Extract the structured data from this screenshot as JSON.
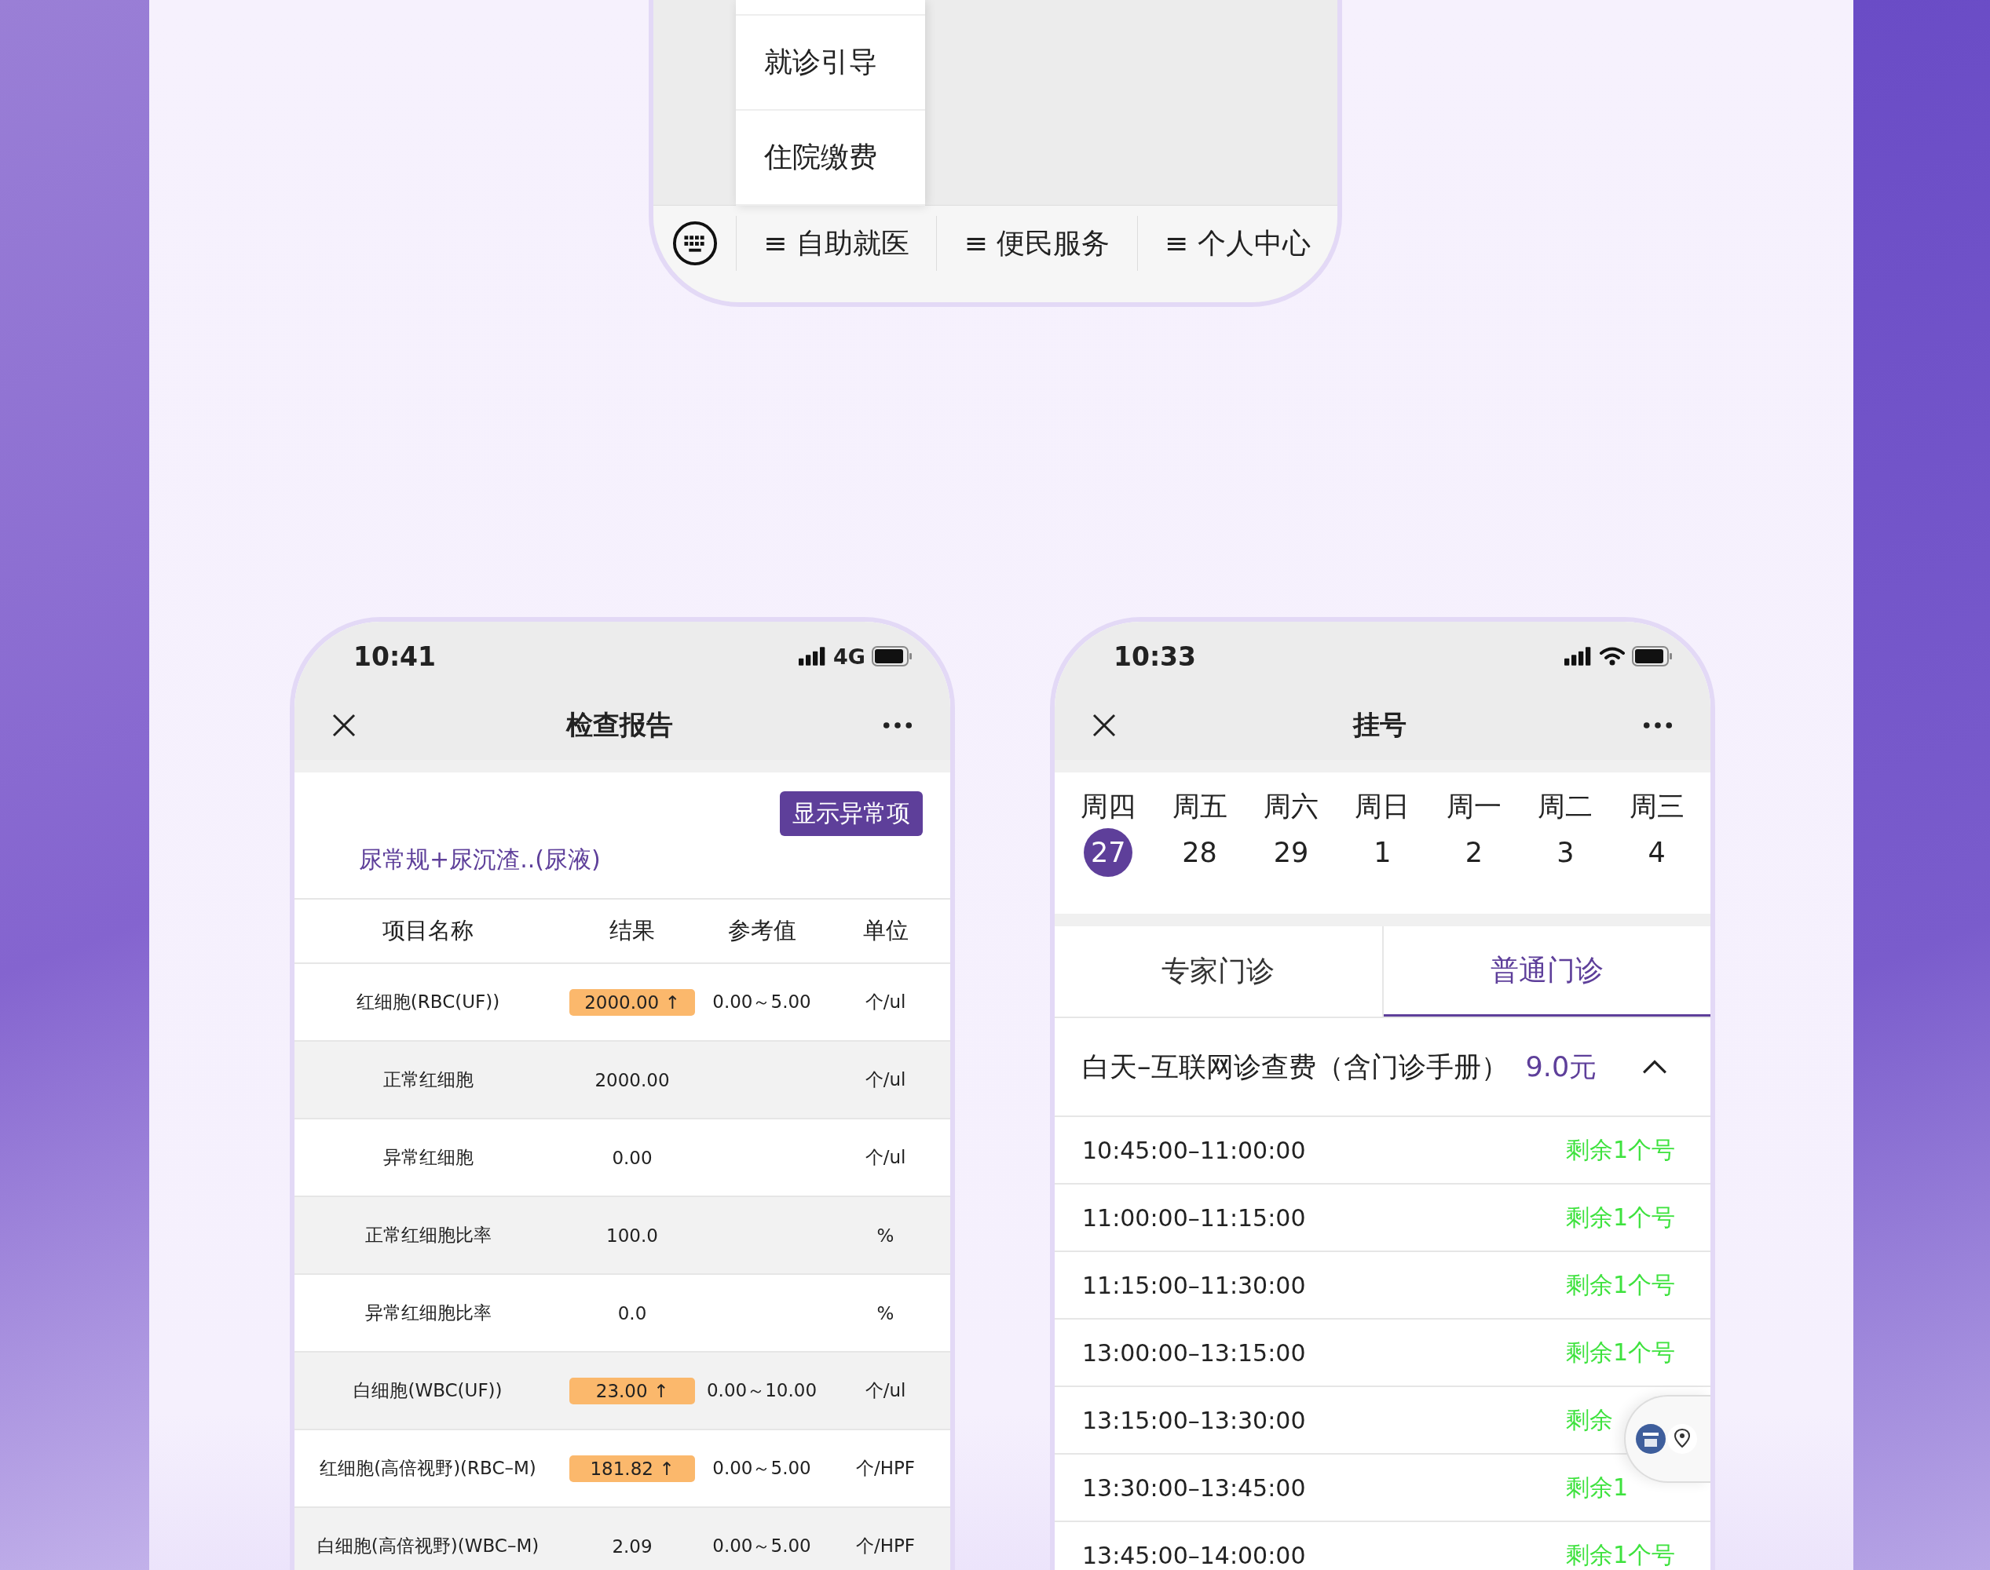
{
  "top_phone": {
    "menu_items": [
      {
        "label": "就诊引导"
      },
      {
        "label": "住院缴费"
      }
    ],
    "tab_bar": [
      {
        "label": "≡ 自助就医"
      },
      {
        "label": "≡ 便民服务"
      },
      {
        "label": "≡ 个人中心"
      }
    ]
  },
  "report_phone": {
    "status": {
      "time": "10:41",
      "network": "4G"
    },
    "title": "检查报告",
    "filter_button": "显示异常项",
    "test_name": "尿常规+尿沉渣..(尿液)",
    "columns": [
      "项目名称",
      "结果",
      "参考值",
      "单位"
    ],
    "rows": [
      {
        "name": "红细胞(RBC(UF))",
        "result": "2000.00 ↑",
        "reference": "0.00～5.00",
        "unit": "个/ul",
        "abnormal": true
      },
      {
        "name": "正常红细胞",
        "result": "2000.00",
        "unit": "个/ul",
        "abnormal": false
      },
      {
        "name": "异常红细胞",
        "result": "0.00",
        "unit": "个/ul",
        "abnormal": false
      },
      {
        "name": "正常红细胞比率",
        "result": "100.0",
        "unit": "%",
        "abnormal": false
      },
      {
        "name": "异常红细胞比率",
        "result": "0.0",
        "unit": "%",
        "abnormal": false
      },
      {
        "name": "白细胞(WBC(UF))",
        "result": "23.00 ↑",
        "reference": "0.00～10.00",
        "unit": "个/ul",
        "abnormal": true
      },
      {
        "name": "红细胞(高倍视野)(RBC–M)",
        "result": "181.82 ↑",
        "reference": "0.00～5.00",
        "unit": "个/HPF",
        "abnormal": true
      },
      {
        "name": "白细胞(高倍视野)(WBC–M)",
        "result": "2.09",
        "reference": "0.00～5.00",
        "unit": "个/HPF",
        "abnormal": false
      }
    ]
  },
  "register_phone": {
    "status": {
      "time": "10:33"
    },
    "title": "挂号",
    "days": [
      {
        "weekday": "周四",
        "date": "27",
        "selected": true
      },
      {
        "weekday": "周五",
        "date": "28",
        "selected": false
      },
      {
        "weekday": "周六",
        "date": "29",
        "selected": false
      },
      {
        "weekday": "周日",
        "date": "1",
        "selected": false
      },
      {
        "weekday": "周一",
        "date": "2",
        "selected": false
      },
      {
        "weekday": "周二",
        "date": "3",
        "selected": false
      },
      {
        "weekday": "周三",
        "date": "4",
        "selected": false
      }
    ],
    "tabs": [
      {
        "label": "专家门诊",
        "selected": false
      },
      {
        "label": "普通门诊",
        "selected": true
      }
    ],
    "fee": {
      "label": "白天–互联网诊查费（含门诊手册）",
      "price": "9.0元",
      "expanded": true
    },
    "slots": [
      {
        "time": "10:45:00–11:00:00",
        "remaining": "剩余1个号"
      },
      {
        "time": "11:00:00–11:15:00",
        "remaining": "剩余1个号"
      },
      {
        "time": "11:15:00–11:30:00",
        "remaining": "剩余1个号"
      },
      {
        "time": "13:00:00–13:15:00",
        "remaining": "剩余1个号"
      },
      {
        "time": "13:15:00–13:30:00",
        "remaining": "剩余"
      },
      {
        "time": "13:30:00–13:45:00",
        "remaining": "剩余1"
      },
      {
        "time": "13:45:00–14:00:00",
        "remaining": "剩余1个号"
      }
    ]
  }
}
